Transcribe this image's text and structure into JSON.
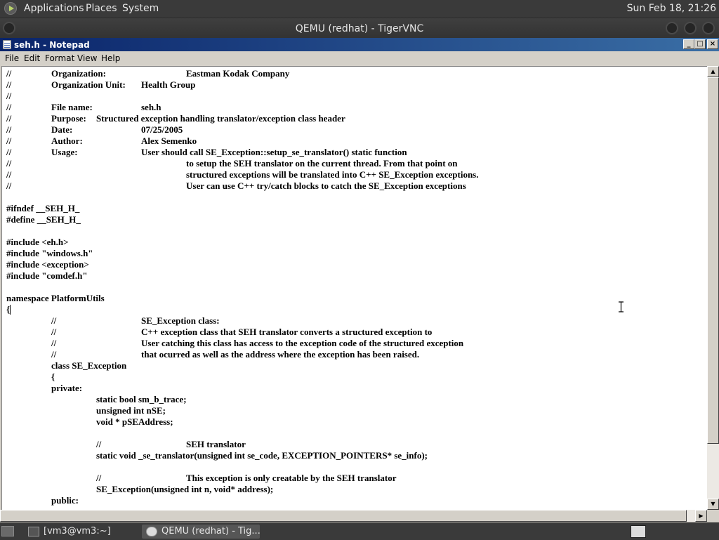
{
  "top_panel": {
    "menus": [
      "Applications",
      "Places",
      "System"
    ],
    "clock": "Sun Feb 18, 21:26"
  },
  "vnc_window": {
    "title": "QEMU (redhat) - TigerVNC"
  },
  "notepad": {
    "title": "seh.h - Notepad",
    "window_buttons": {
      "minimize": "_",
      "maximize": "□",
      "close": "×"
    },
    "menus": [
      "File",
      "Edit",
      "Format",
      "View",
      "Help"
    ],
    "lines": [
      "//\tOrganization:\t\tEastman Kodak Company",
      "//\tOrganization Unit:\tHealth Group",
      "//",
      "//\tFile name:\t\tseh.h",
      "//\tPurpose:\tStructured exception handling translator/exception class header",
      "//\tDate:\t\t07/25/2005",
      "//\tAuthor:\t\tAlex Semenko",
      "//\tUsage:\t\tUser should call SE_Exception::setup_se_translator() static function",
      "//\t\t\t\tto setup the SEH translator on the current thread. From that point on",
      "//\t\t\t\tstructured exceptions will be translated into C++ SE_Exception exceptions.",
      "//\t\t\t\tUser can use C++ try/catch blocks to catch the SE_Exception exceptions",
      "",
      "#ifndef __SEH_H_",
      "#define __SEH_H_",
      "",
      "#include <eh.h>",
      "#include \"windows.h\"",
      "#include <exception>",
      "#include \"comdef.h\"",
      "",
      "namespace PlatformUtils",
      "{",
      "\t//\t\tSE_Exception class:",
      "\t//\t\tC++ exception class that SEH translator converts a structured exception to",
      "\t//\t\tUser catching this class has access to the exception code of the structured exception",
      "\t//\t\tthat ocurred as well as the address where the exception has been raised.",
      "\tclass SE_Exception",
      "\t{",
      "\tprivate:",
      "\t\tstatic bool sm_b_trace;",
      "\t\tunsigned int nSE;",
      "\t\tvoid * pSEAddress;",
      "",
      "\t\t//\t\tSEH translator",
      "\t\tstatic void _se_translator(unsigned int se_code, EXCEPTION_POINTERS* se_info);",
      "",
      "\t\t//\t\tThis exception is only creatable by the SEH translator",
      "\t\tSE_Exception(unsigned int n, void* address);",
      "\tpublic:"
    ]
  },
  "taskbar": {
    "items": [
      "[vm3@vm3:~]",
      "QEMU (redhat) - Tig..."
    ]
  }
}
